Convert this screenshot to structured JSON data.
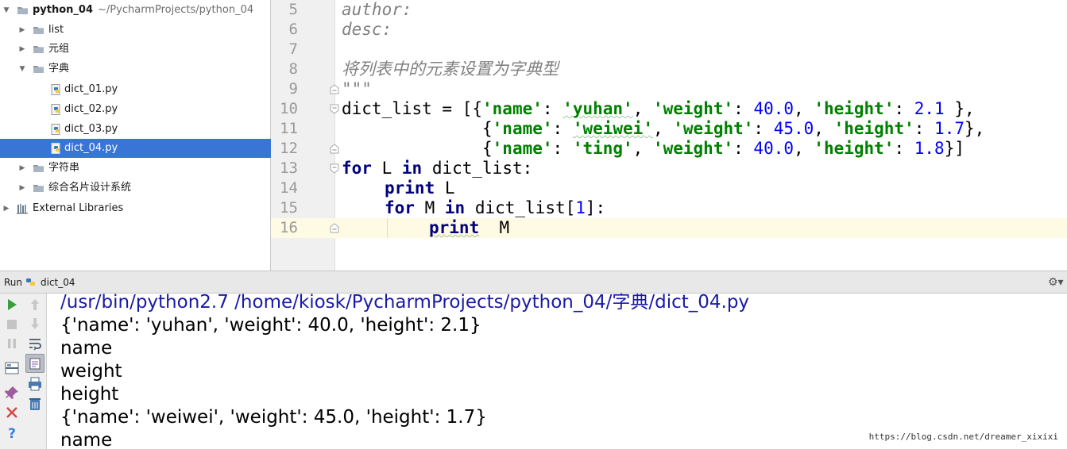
{
  "project_tree": {
    "root": {
      "name": "python_04",
      "path": "~/PycharmProjects/python_04"
    },
    "items": [
      {
        "label": "list"
      },
      {
        "label": "元组"
      },
      {
        "label": "字典"
      },
      {
        "label": "dict_01.py"
      },
      {
        "label": "dict_02.py"
      },
      {
        "label": "dict_03.py"
      },
      {
        "label": "dict_04.py",
        "selected": true
      },
      {
        "label": "字符串"
      },
      {
        "label": "综合名片设计系统"
      },
      {
        "label": "External Libraries"
      }
    ]
  },
  "editor": {
    "line_numbers": [
      "5",
      "6",
      "7",
      "8",
      "9",
      "10",
      "11",
      "12",
      "13",
      "14",
      "15",
      "16"
    ],
    "code": {
      "l5": "author:",
      "l6": "desc:",
      "l8": "将列表中的元素设置为字典型",
      "l9": "\"\"\"",
      "l10": {
        "p1": "dict_list = [{",
        "s1": "'name'",
        "p2": ": ",
        "s2": "'yuhan'",
        "p3": ", ",
        "s3": "'weight'",
        "p4": ": ",
        "n1": "40.0",
        "p5": ", ",
        "s4": "'height'",
        "p6": ": ",
        "n2": "2.1",
        "p7": " },"
      },
      "l11": {
        "p1": "              {",
        "s1": "'name'",
        "p2": ": ",
        "s2": "'weiwei'",
        "p3": ", ",
        "s3": "'weight'",
        "p4": ": ",
        "n1": "45.0",
        "p5": ", ",
        "s4": "'height'",
        "p6": ": ",
        "n2": "1.7",
        "p7": "},"
      },
      "l12": {
        "p1": "              {",
        "s1": "'name'",
        "p2": ": ",
        "s2": "'ting'",
        "p3": ", ",
        "s3": "'weight'",
        "p4": ": ",
        "n1": "40.0",
        "p5": ", ",
        "s4": "'height'",
        "p6": ": ",
        "n2": "1.8",
        "p7": "}]"
      },
      "l13": {
        "k1": "for",
        "t1": " L ",
        "k2": "in",
        "t2": " dict_list:"
      },
      "l14": {
        "k1": "print",
        "t1": " L"
      },
      "l15": {
        "k1": "for",
        "t1": " M ",
        "k2": "in",
        "t2": " dict_list[",
        "n1": "1",
        "t3": "]:"
      },
      "l16": {
        "k1": "print",
        "t1": "  M"
      }
    }
  },
  "run_window": {
    "tab_label": "Run",
    "config_name": "dict_04",
    "output": [
      "/usr/bin/python2.7 /home/kiosk/PycharmProjects/python_04/字典/dict_04.py",
      "{'name': 'yuhan', 'weight': 40.0, 'height': 2.1}",
      "name",
      "weight",
      "height",
      "{'name': 'weiwei', 'weight': 45.0, 'height': 1.7}",
      "name"
    ],
    "watermark": "https://blog.csdn.net/dreamer_xixixi"
  },
  "colors": {
    "selection": "#3875d6",
    "keyword": "#000080",
    "string": "#008000",
    "number": "#0000ff",
    "comment": "#808080",
    "caret_line": "#fffae3",
    "command_output": "#1a1aa8"
  },
  "icons": {
    "folder": "folder-icon",
    "python_file": "python-file-icon",
    "libraries": "external-libraries-icon",
    "run_tool_buttons": [
      "run-icon",
      "stop-icon",
      "pause-icon",
      "layout-icon",
      "pin-icon",
      "close-icon",
      "help-icon",
      "scroll-up-icon",
      "scroll-down-icon",
      "soft-wrap-icon",
      "scroll-to-end-icon",
      "print-icon",
      "clear-icon"
    ]
  }
}
